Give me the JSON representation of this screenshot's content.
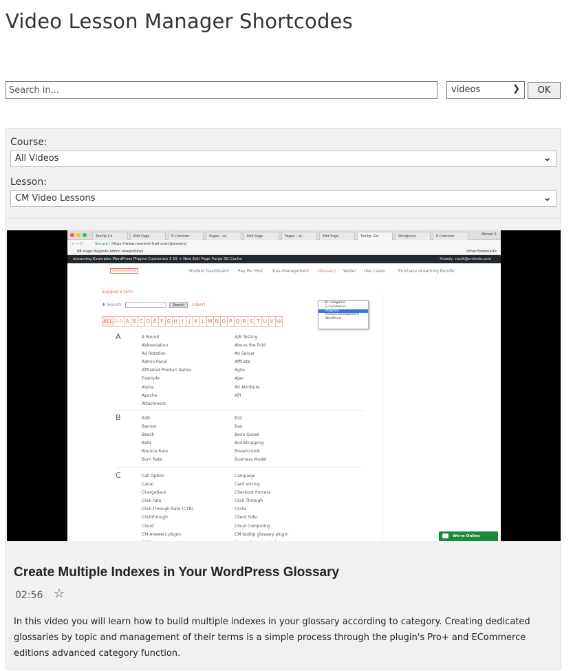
{
  "page": {
    "title": "Video Lesson Manager Shortcodes"
  },
  "search": {
    "placeholder": "Search in...",
    "type_value": "videos",
    "ok_label": "OK"
  },
  "filters": {
    "course_label": "Course:",
    "course_value": "All Videos",
    "lesson_label": "Lesson:",
    "lesson_value": "CM Video Lessons"
  },
  "video": {
    "browser": {
      "tabs": [
        "Tooltip Co",
        "Edit Page",
        "E-Commer",
        "Pages ‹ eL",
        "Edit Page",
        "Pages ‹ eL",
        "Edit Page",
        "Tooltip Glo",
        "Wordpress",
        "E-Commer"
      ],
      "person": "Person 1",
      "secure": "Secure",
      "url": "https://www.researchtrail.com/glossary/",
      "bookmarks": "KB   stage   Magento   Admin   researchtrail",
      "other_bookmarks": "Other Bookmarks",
      "admin_bar": "eLearning Examples WordPress Plugins    Customize    3    15    + New    Edit Page    Purge SG Cache",
      "admin_user": "Howdy, navit@cminds.com"
    },
    "site_logo": "creativeminds",
    "nav": [
      "Student Dashboard",
      "Pay Per Post",
      "Idea Management",
      "Glossary",
      "Wallet",
      "Use Cases",
      "Purchase eLearning Bundle"
    ],
    "suggest": "Suggest a term",
    "search_label": "Search:",
    "search_btn": "Search",
    "clear": "(clear)",
    "letters": [
      "ALL",
      "0-9",
      "A",
      "B",
      "C",
      "D",
      "E",
      "F",
      "G",
      "H",
      "I",
      "J",
      "K",
      "L",
      "M",
      "N",
      "O",
      "P",
      "Q",
      "R",
      "S",
      "T",
      "U",
      "V",
      "W"
    ],
    "categories": [
      "All Categories",
      "E-Commerce",
      "Magento",
      "Product Development",
      "WordPress"
    ],
    "sections": [
      {
        "letter": "A",
        "left": [
          "A Round",
          "Abbreviation",
          "Ad Rotation",
          "Admin Panel",
          "Affiliated Product Name-",
          "Example",
          "Alpha",
          "Apache",
          "Attachment"
        ],
        "right": [
          "A/B Testing",
          "Above the Fold",
          "Ad Server",
          "Affiliate",
          "Agile",
          "Ajax",
          "Alt Attribute",
          "API"
        ]
      },
      {
        "letter": "B",
        "left": [
          "B2B",
          "Banner",
          "Beach",
          "Beta",
          "Bounce Rate",
          "Burn Rate"
        ],
        "right": [
          "B2C",
          "Bay",
          "Bean Goose",
          "Bootstrapping",
          "Breadcrumb",
          "Business Model"
        ]
      },
      {
        "letter": "C",
        "left": [
          "Call Option",
          "Canal",
          "Chargeback",
          "Click rate",
          "Click-Through Rate (CTR)",
          "Clickthrough",
          "Cloud",
          "CM Answers plugin",
          "CMS"
        ],
        "right": [
          "Campaign",
          "Card sorting",
          "Checkout Process",
          "Click Through",
          "Clicks",
          "Client Side",
          "Cloud Computing",
          "CM tooltip glossary plugin",
          "Competitive Analysis"
        ]
      }
    ],
    "online": "We're Online"
  },
  "lesson": {
    "title": "Create Multiple Indexes in Your WordPress Glossary",
    "duration": "02:56",
    "star": "☆",
    "description": "In this video you will learn how to build multiple indexes in your glossary according to category. Creating dedicated glossaries by topic and management of their terms is a simple process through the plugin's Pro+ and ECommerce editions advanced category function."
  },
  "colors": {
    "accent": "#e67060",
    "online": "#1c8a3a",
    "admin_bar": "#23282d"
  }
}
